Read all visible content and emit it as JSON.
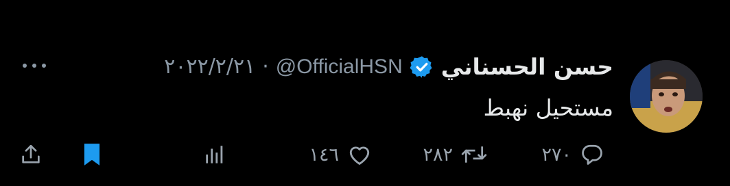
{
  "tweet": {
    "author_name": "حسن الحسناني",
    "handle": "@OfficialHSN",
    "separator": "·",
    "date": "٢٠٢٢/٢/٢١",
    "text": "مستحيل نهبط",
    "verified": true
  },
  "actions": {
    "replies": "٢٧٠",
    "retweets": "٢٨٢",
    "likes": "١٤٦",
    "bookmarked": true
  },
  "colors": {
    "background": "#000000",
    "text": "#e7e9ea",
    "muted": "#8b98a5",
    "verified": "#1d9bf0",
    "bookmark_active": "#1d9bf0"
  },
  "icons": {
    "more": "more-icon",
    "reply": "reply-icon",
    "retweet": "retweet-icon",
    "like": "heart-icon",
    "views": "views-icon",
    "bookmark": "bookmark-icon",
    "share": "share-icon",
    "verified": "verified-badge-icon"
  }
}
